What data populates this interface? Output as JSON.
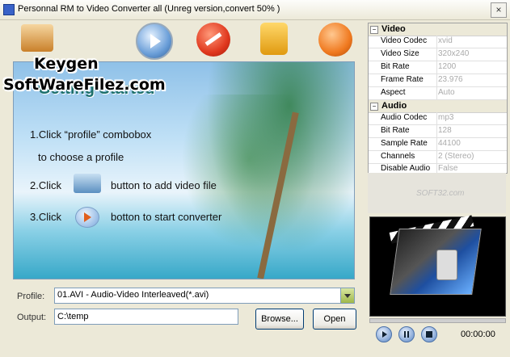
{
  "window": {
    "title": "Personnal RM to Video Converter all (Unreg version,convert 50% )",
    "close_label": "×"
  },
  "watermark": {
    "line1": "Keygen",
    "line2": "SoftWareFilez.com"
  },
  "toolbar": {
    "add": "add-video-icon",
    "convert": "convert-play-icon",
    "stop": "stop-icon",
    "register": "lock-icon",
    "help": "help-icon"
  },
  "banner": {
    "title": "Getting Started",
    "step1": "1.Click “profile” combobox",
    "step1b": "to choose a profile",
    "step2a": "2.Click",
    "step2b": "button to add video file",
    "step3a": "3.Click",
    "step3b": "botton to start converter"
  },
  "form": {
    "profile_label": "Profile:",
    "profile_value": "01.AVI - Audio-Video Interleaved(*.avi)",
    "output_label": "Output:",
    "output_value": "C:\\temp",
    "browse_label": "Browse...",
    "open_label": "Open"
  },
  "properties": {
    "video": {
      "category": "Video",
      "rows": [
        {
          "name": "Video Codec",
          "value": "xvid"
        },
        {
          "name": "Video Size",
          "value": "320x240"
        },
        {
          "name": "Bit Rate",
          "value": "1200"
        },
        {
          "name": "Frame Rate",
          "value": "23.976"
        },
        {
          "name": "Aspect",
          "value": "Auto"
        }
      ]
    },
    "audio": {
      "category": "Audio",
      "rows": [
        {
          "name": "Audio Codec",
          "value": "mp3"
        },
        {
          "name": "Bit Rate",
          "value": "128"
        },
        {
          "name": "Sample Rate",
          "value": "44100"
        },
        {
          "name": "Channels",
          "value": "2 (Stereo)"
        },
        {
          "name": "Disable Audio",
          "value": "False"
        }
      ]
    },
    "toggle_symbol": "−"
  },
  "soft_watermark": "SOFT32.com",
  "player": {
    "time": "00:00:00"
  }
}
